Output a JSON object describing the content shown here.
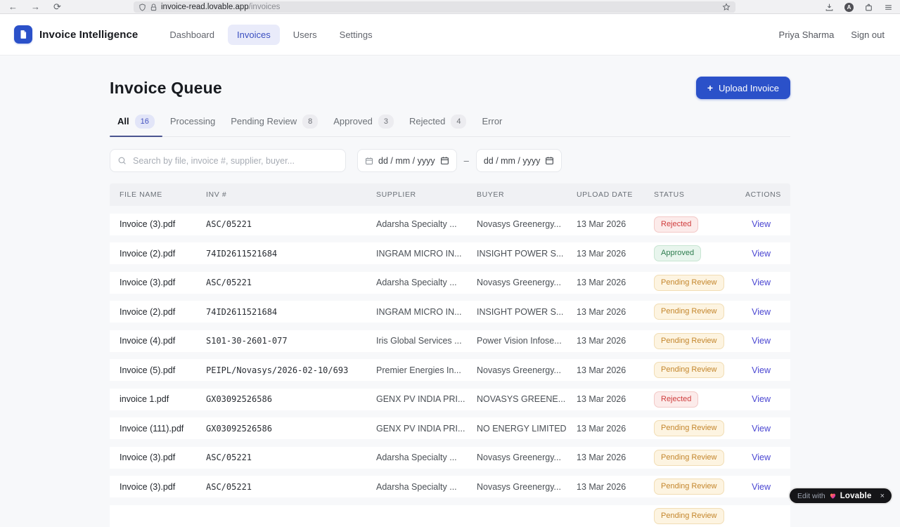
{
  "browser": {
    "url_host": "invoice-read.lovable.app",
    "url_path": "/invoices",
    "avatar_letter": "A"
  },
  "header": {
    "app_name": "Invoice Intelligence",
    "nav": [
      {
        "label": "Dashboard"
      },
      {
        "label": "Invoices"
      },
      {
        "label": "Users"
      },
      {
        "label": "Settings"
      }
    ],
    "user_name": "Priya Sharma",
    "sign_out": "Sign out"
  },
  "page": {
    "title": "Invoice Queue",
    "upload_plus": "+",
    "upload_label": "Upload Invoice"
  },
  "tabs": [
    {
      "label": "All",
      "count": "16"
    },
    {
      "label": "Processing"
    },
    {
      "label": "Pending Review",
      "count": "8"
    },
    {
      "label": "Approved",
      "count": "3"
    },
    {
      "label": "Rejected",
      "count": "4"
    },
    {
      "label": "Error"
    }
  ],
  "filters": {
    "search_placeholder": "Search by file, invoice #, supplier, buyer...",
    "date_from": "dd / mm / yyyy",
    "date_to": "dd / mm / yyyy",
    "range_separator": "–"
  },
  "table": {
    "columns": [
      "FILE NAME",
      "INV #",
      "SUPPLIER",
      "BUYER",
      "UPLOAD DATE",
      "STATUS",
      "ACTIONS"
    ],
    "rows": [
      {
        "file": "Invoice (3).pdf",
        "inv": "ASC/05221",
        "supplier": "Adarsha Specialty ...",
        "buyer": "Novasys Greenergy...",
        "date": "13 Mar 2026",
        "status": "Rejected",
        "status_key": "rejected",
        "action": "View"
      },
      {
        "file": "Invoice (2).pdf",
        "inv": "74ID2611521684",
        "supplier": "INGRAM MICRO IN...",
        "buyer": "INSIGHT POWER S...",
        "date": "13 Mar 2026",
        "status": "Approved",
        "status_key": "approved",
        "action": "View"
      },
      {
        "file": "Invoice (3).pdf",
        "inv": "ASC/05221",
        "supplier": "Adarsha Specialty ...",
        "buyer": "Novasys Greenergy...",
        "date": "13 Mar 2026",
        "status": "Pending Review",
        "status_key": "pending",
        "action": "View"
      },
      {
        "file": "Invoice (2).pdf",
        "inv": "74ID2611521684",
        "supplier": "INGRAM MICRO IN...",
        "buyer": "INSIGHT POWER S...",
        "date": "13 Mar 2026",
        "status": "Pending Review",
        "status_key": "pending",
        "action": "View"
      },
      {
        "file": "Invoice (4).pdf",
        "inv": "S101-30-2601-077",
        "supplier": "Iris Global Services ...",
        "buyer": "Power Vision Infose...",
        "date": "13 Mar 2026",
        "status": "Pending Review",
        "status_key": "pending",
        "action": "View"
      },
      {
        "file": "Invoice (5).pdf",
        "inv": "PEIPL/Novasys/2026-02-10/693",
        "supplier": "Premier Energies In...",
        "buyer": "Novasys Greenergy...",
        "date": "13 Mar 2026",
        "status": "Pending Review",
        "status_key": "pending",
        "action": "View"
      },
      {
        "file": "invoice 1.pdf",
        "inv": "GX03092526586",
        "supplier": "GENX PV INDIA PRI...",
        "buyer": "NOVASYS GREENE...",
        "date": "13 Mar 2026",
        "status": "Rejected",
        "status_key": "rejected",
        "action": "View"
      },
      {
        "file": "Invoice (111).pdf",
        "inv": "GX03092526586",
        "supplier": "GENX PV INDIA PRI...",
        "buyer": "NO ENERGY LIMITED",
        "date": "13 Mar 2026",
        "status": "Pending Review",
        "status_key": "pending",
        "action": "View"
      },
      {
        "file": "Invoice (3).pdf",
        "inv": "ASC/05221",
        "supplier": "Adarsha Specialty ...",
        "buyer": "Novasys Greenergy...",
        "date": "13 Mar 2026",
        "status": "Pending Review",
        "status_key": "pending",
        "action": "View"
      },
      {
        "file": "Invoice (3).pdf",
        "inv": "ASC/05221",
        "supplier": "Adarsha Specialty ...",
        "buyer": "Novasys Greenergy...",
        "date": "13 Mar 2026",
        "status": "Pending Review",
        "status_key": "pending",
        "action": "View"
      }
    ],
    "partial_row": {
      "status": "Pending Review",
      "status_key": "pending"
    }
  },
  "lovable_badge": {
    "prefix": "Edit with",
    "brand": "Lovable",
    "close": "×"
  },
  "colors": {
    "primary_blue": "#2b51c9",
    "page_bg": "#f7f8fa",
    "rejected_text": "#cf3d3d",
    "approved_text": "#2e7d4f",
    "pending_text": "#c4862c",
    "link_indigo": "#4a46d2"
  }
}
